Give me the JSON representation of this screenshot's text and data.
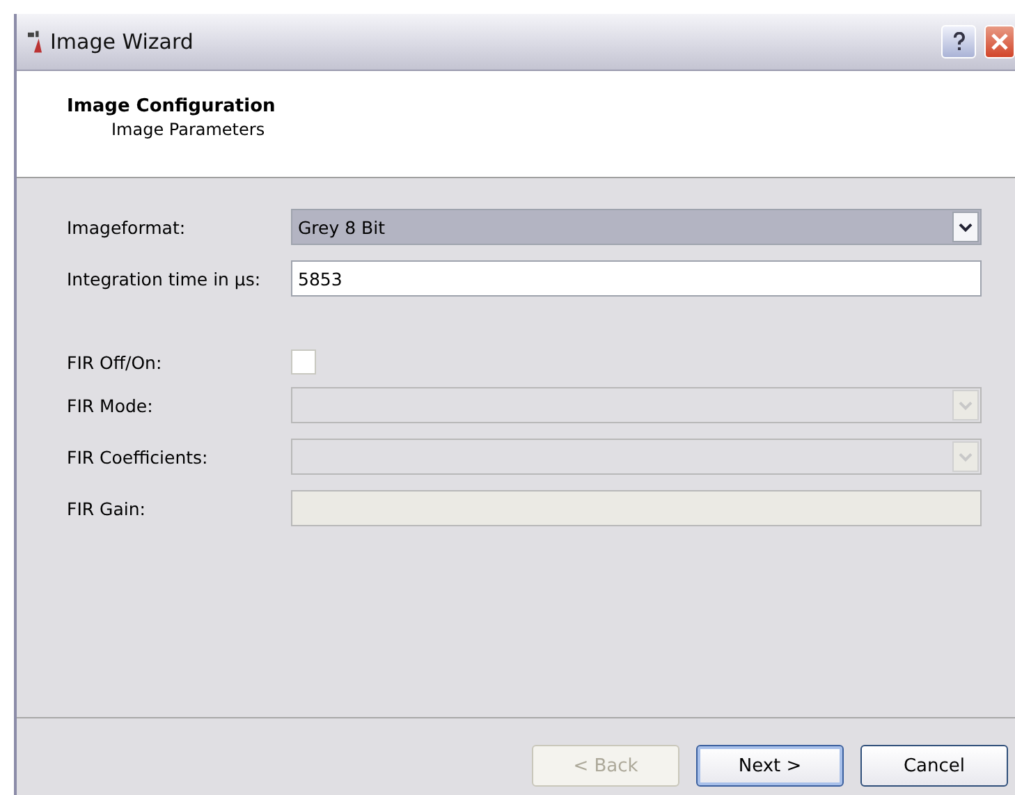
{
  "window": {
    "title": "Image Wizard"
  },
  "header": {
    "title": "Image Configuration",
    "subtitle": "Image Parameters"
  },
  "fields": [
    {
      "kind": "combo",
      "label": "Imageformat:",
      "value": "Grey 8 Bit",
      "disabled": false
    },
    {
      "kind": "text",
      "label": "Integration time in µs:",
      "value": "5853",
      "disabled": false
    },
    {
      "kind": "checkbox",
      "label": "FIR Off/On:",
      "checked": false,
      "disabled": false
    },
    {
      "kind": "combo",
      "label": "FIR Mode:",
      "disabled": true
    },
    {
      "kind": "combo",
      "label": "FIR Coefficients:",
      "disabled": true
    },
    {
      "kind": "text",
      "label": "FIR Gain:",
      "disabled": true
    }
  ],
  "buttons": [
    {
      "label": "< Back",
      "disabled": true,
      "default": false
    },
    {
      "label": "Next >",
      "disabled": false,
      "default": true
    },
    {
      "label": "Cancel",
      "disabled": false,
      "default": false
    }
  ]
}
